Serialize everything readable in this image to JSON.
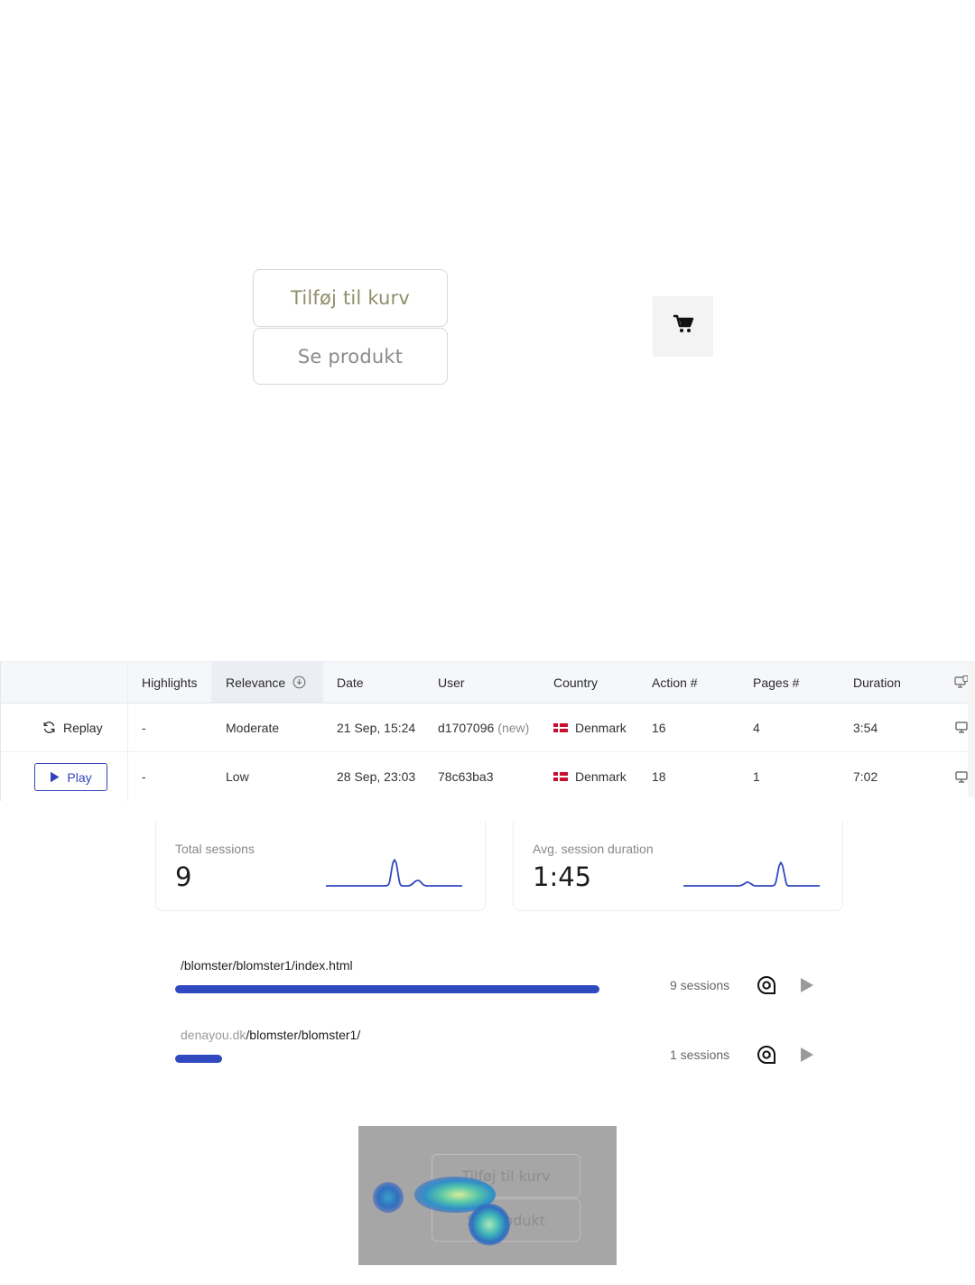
{
  "product": {
    "add_to_cart": "Tilføj til kurv",
    "view_product": "Se produkt",
    "cart_icon": "cart-icon"
  },
  "table": {
    "headers": {
      "highlights": "Highlights",
      "relevance": "Relevance",
      "date": "Date",
      "user": "User",
      "country": "Country",
      "actions": "Action #",
      "pages": "Pages #",
      "duration": "Duration"
    },
    "rows": [
      {
        "action": "Replay",
        "highlights": "-",
        "relevance": "Moderate",
        "date": "21 Sep, 15:24",
        "user": "d1707096",
        "user_tag": "(new)",
        "country": "Denmark",
        "actions": "16",
        "pages": "4",
        "duration": "3:54"
      },
      {
        "action": "Play",
        "highlights": "-",
        "relevance": "Low",
        "date": "28 Sep, 23:03",
        "user": "78c63ba3",
        "user_tag": "",
        "country": "Denmark",
        "actions": "18",
        "pages": "1",
        "duration": "7:02"
      }
    ]
  },
  "stats": {
    "total_sessions": {
      "label": "Total sessions",
      "value": "9"
    },
    "avg_duration": {
      "label": "Avg. session duration",
      "value": "1:45"
    }
  },
  "pages": [
    {
      "domain": "",
      "path": "/blomster/blomster1/index.html",
      "sessions": 9,
      "sessions_label": "9 sessions",
      "share": 1.0
    },
    {
      "domain": "denayou.dk",
      "path": "/blomster/blomster1/",
      "sessions": 1,
      "sessions_label": "1 sessions",
      "share": 0.11
    }
  ],
  "heatmap": {
    "add_to_cart": "Tilføj til kurv",
    "view_product": "Se produkt"
  },
  "colors": {
    "accent": "#3149bf",
    "denmark_flag": "#c8102e"
  }
}
